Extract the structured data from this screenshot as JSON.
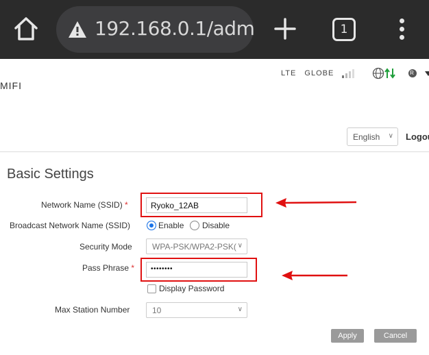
{
  "browser": {
    "url": "192.168.0.1/adm",
    "tab_count": "1"
  },
  "header": {
    "brand": "MIFI",
    "network_type": "LTE",
    "carrier": "GLOBE",
    "roaming_badge": "R",
    "language": "English",
    "logout_label": "Logou"
  },
  "page": {
    "title": "Basic Settings"
  },
  "form": {
    "ssid_label": "Network Name (SSID)",
    "required_mark": "*",
    "ssid_value": "Ryoko_12AB",
    "broadcast_label": "Broadcast Network Name (SSID)",
    "enable_label": "Enable",
    "disable_label": "Disable",
    "security_label": "Security Mode",
    "security_value": "WPA-PSK/WPA2-PSK(",
    "pass_label": "Pass Phrase",
    "pass_value": "••••••••",
    "display_password_label": "Display Password",
    "max_station_label": "Max Station Number",
    "max_station_value": "10",
    "apply_label": "Apply",
    "cancel_label": "Cancel"
  },
  "colors": {
    "annotation": "#e01010",
    "radio_selected": "#1a73e8",
    "network_arrows": "#1e9e3a"
  }
}
